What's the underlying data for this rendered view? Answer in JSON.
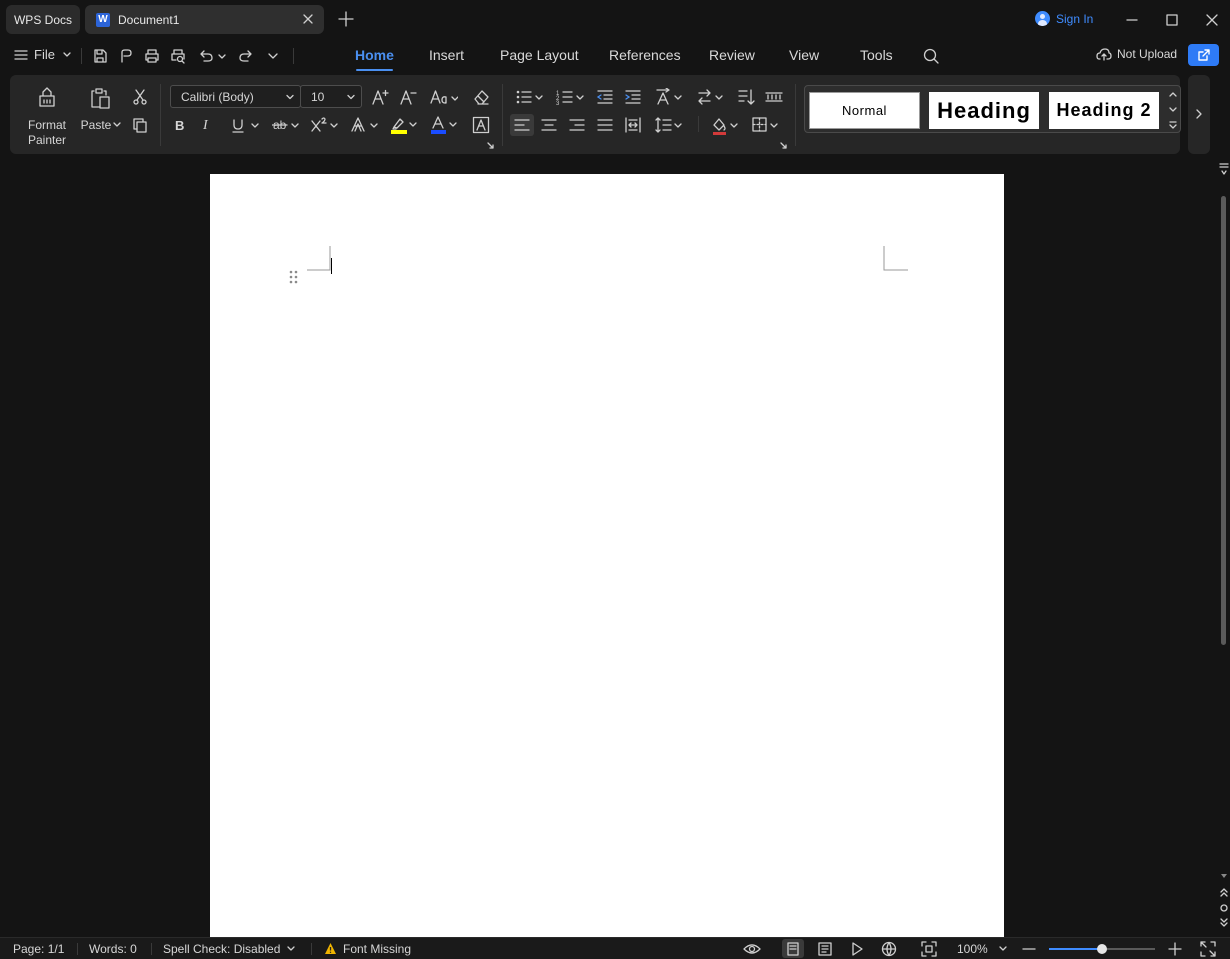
{
  "titlebar": {
    "home_tab": "WPS Docs",
    "doc_tab": "Document1",
    "sign_in": "Sign In"
  },
  "menubar": {
    "file": "File",
    "tabs": [
      {
        "label": "Home",
        "active": true
      },
      {
        "label": "Insert"
      },
      {
        "label": "Page Layout"
      },
      {
        "label": "References"
      },
      {
        "label": "Review"
      },
      {
        "label": "View"
      },
      {
        "label": "Tools"
      }
    ],
    "cloud_status": "Not Upload"
  },
  "ribbon": {
    "format_painter_line1": "Format",
    "format_painter_line2": "Painter",
    "paste": "Paste",
    "font_name": "Calibri (Body)",
    "font_size": "10",
    "styles": [
      "Normal",
      "Heading",
      "Heading 2"
    ]
  },
  "statusbar": {
    "page": "Page: 1/1",
    "words": "Words: 0",
    "spell_check": "Spell Check: Disabled",
    "font_missing": "Font Missing",
    "zoom": "100%",
    "zoom_level": 0.5
  },
  "colors": {
    "accent": "#4a8ff0",
    "highlight": "#ffff00",
    "font_color": "#1a4cff",
    "share_button": "#2e7bf6"
  }
}
